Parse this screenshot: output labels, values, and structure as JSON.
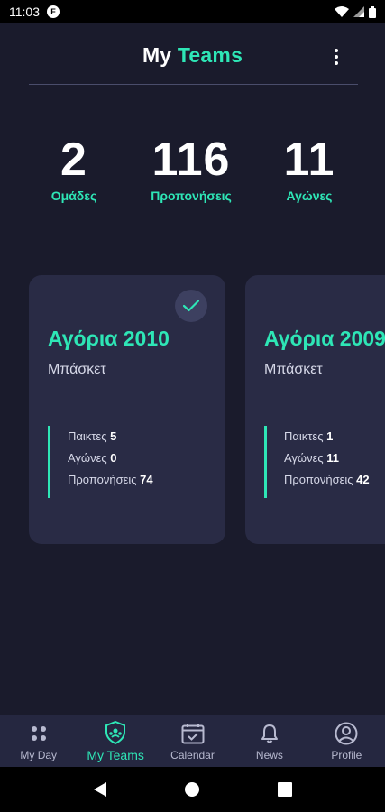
{
  "status_bar": {
    "time": "11:03",
    "app_badge": "F"
  },
  "header": {
    "title_prefix": "My",
    "title_accent": "Teams",
    "menu_icon": "more-vert-icon"
  },
  "stats": [
    {
      "value": "2",
      "label": "Ομάδες"
    },
    {
      "value": "116",
      "label": "Προπονήσεις"
    },
    {
      "value": "11",
      "label": "Αγώνες"
    }
  ],
  "teams": [
    {
      "name": "Αγόρια 2010",
      "sport": "Μπάσκετ",
      "selected": true,
      "players_label": "Παικτες",
      "players": "5",
      "games_label": "Αγώνες",
      "games": "0",
      "trainings_label": "Προπονήσεις",
      "trainings": "74"
    },
    {
      "name": "Αγόρια 2009",
      "sport": "Μπάσκετ",
      "selected": false,
      "players_label": "Παικτες",
      "players": "1",
      "games_label": "Αγώνες",
      "games": "11",
      "trainings_label": "Προπονήσεις",
      "trainings": "42"
    }
  ],
  "bottom_nav": [
    {
      "label": "My Day",
      "icon": "dots-grid-icon",
      "active": false
    },
    {
      "label": "My Teams",
      "icon": "shield-team-icon",
      "active": true
    },
    {
      "label": "Calendar",
      "icon": "calendar-check-icon",
      "active": false
    },
    {
      "label": "News",
      "icon": "bell-icon",
      "active": false
    },
    {
      "label": "Profile",
      "icon": "profile-icon",
      "active": false
    }
  ],
  "colors": {
    "accent": "#2ee6b6",
    "background": "#1a1b2c",
    "card": "#292b45",
    "nav": "#252740"
  }
}
